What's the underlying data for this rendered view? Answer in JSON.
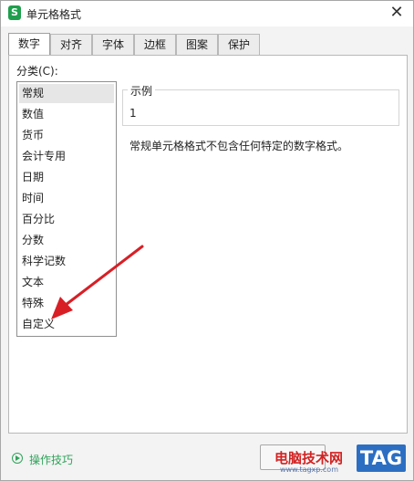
{
  "window": {
    "app_icon_letter": "S",
    "title": "单元格格式",
    "close_symbol": "✕"
  },
  "tabs": [
    {
      "label": "数字",
      "active": true
    },
    {
      "label": "对齐",
      "active": false
    },
    {
      "label": "字体",
      "active": false
    },
    {
      "label": "边框",
      "active": false
    },
    {
      "label": "图案",
      "active": false
    },
    {
      "label": "保护",
      "active": false
    }
  ],
  "category": {
    "label": "分类(C):",
    "selected": "常规",
    "items": [
      "常规",
      "数值",
      "货币",
      "会计专用",
      "日期",
      "时间",
      "百分比",
      "分数",
      "科学记数",
      "文本",
      "特殊",
      "自定义"
    ]
  },
  "sample": {
    "legend": "示例",
    "value": "1"
  },
  "description": "常规单元格格式不包含任何特定的数字格式。",
  "footer": {
    "tips_label": "操作技巧"
  },
  "watermark": {
    "main": "电脑技术网",
    "url": "www.tagxp.com",
    "tag": "TAG"
  },
  "colors": {
    "accent_green": "#2fa35a",
    "annotation_arrow": "#d81f26",
    "watermark_red": "#d22222",
    "watermark_blue": "#2c6fc2"
  },
  "icons": {
    "app": "spreadsheet-app-icon",
    "close": "close-icon",
    "tips": "play-circle-icon"
  }
}
